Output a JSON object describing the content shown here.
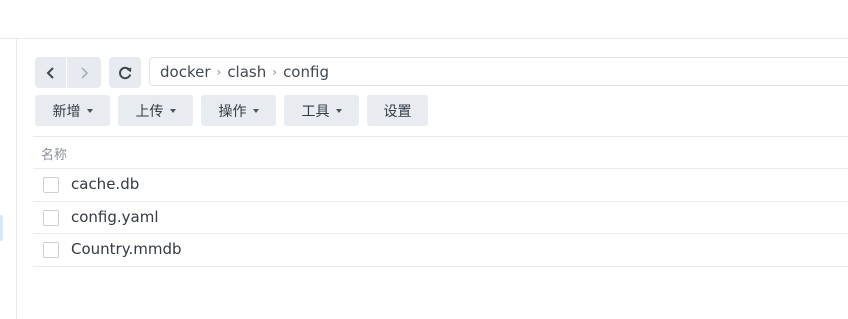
{
  "breadcrumb": [
    "docker",
    "clash",
    "config"
  ],
  "breadcrumb_separator": "›",
  "nav": {
    "back_icon": "chevron-left-icon",
    "forward_icon": "chevron-right-icon",
    "refresh_icon": "refresh-icon"
  },
  "toolbar": {
    "new_label": "新增",
    "upload_label": "上传",
    "action_label": "操作",
    "tools_label": "工具",
    "settings_label": "设置"
  },
  "list": {
    "column_name": "名称",
    "files": [
      "cache.db",
      "config.yaml",
      "Country.mmdb"
    ]
  }
}
